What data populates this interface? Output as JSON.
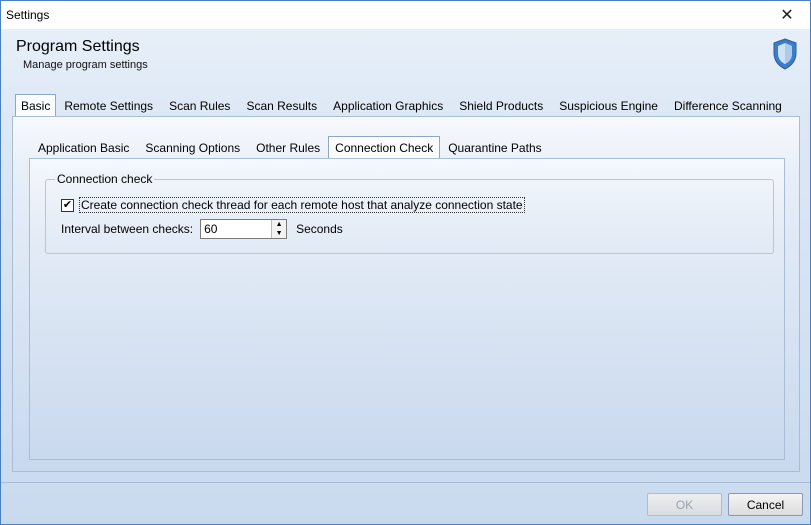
{
  "window": {
    "title": "Settings"
  },
  "header": {
    "title": "Program Settings",
    "subtitle": "Manage program settings"
  },
  "outer_tabs": [
    {
      "label": "Basic",
      "active": true
    },
    {
      "label": "Remote Settings",
      "active": false
    },
    {
      "label": "Scan Rules",
      "active": false
    },
    {
      "label": "Scan Results",
      "active": false
    },
    {
      "label": "Application Graphics",
      "active": false
    },
    {
      "label": "Shield Products",
      "active": false
    },
    {
      "label": "Suspicious Engine",
      "active": false
    },
    {
      "label": "Difference Scanning",
      "active": false
    }
  ],
  "inner_tabs": [
    {
      "label": "Application Basic",
      "active": false
    },
    {
      "label": "Scanning Options",
      "active": false
    },
    {
      "label": "Other Rules",
      "active": false
    },
    {
      "label": "Connection Check",
      "active": true
    },
    {
      "label": "Quarantine Paths",
      "active": false
    }
  ],
  "connection_check": {
    "group_label": "Connection check",
    "checkbox_label": "Create connection check thread for each remote host that analyze connection state",
    "checkbox_checked": true,
    "checkmark": "✔",
    "interval_label": "Interval between checks:",
    "interval_value": "60",
    "interval_unit": "Seconds"
  },
  "buttons": {
    "ok": "OK",
    "cancel": "Cancel"
  },
  "icons": {
    "close": "close-icon",
    "shield": "shield-icon"
  },
  "colors": {
    "accent": "#4a7fc1",
    "shield": "#3d7cc9"
  }
}
